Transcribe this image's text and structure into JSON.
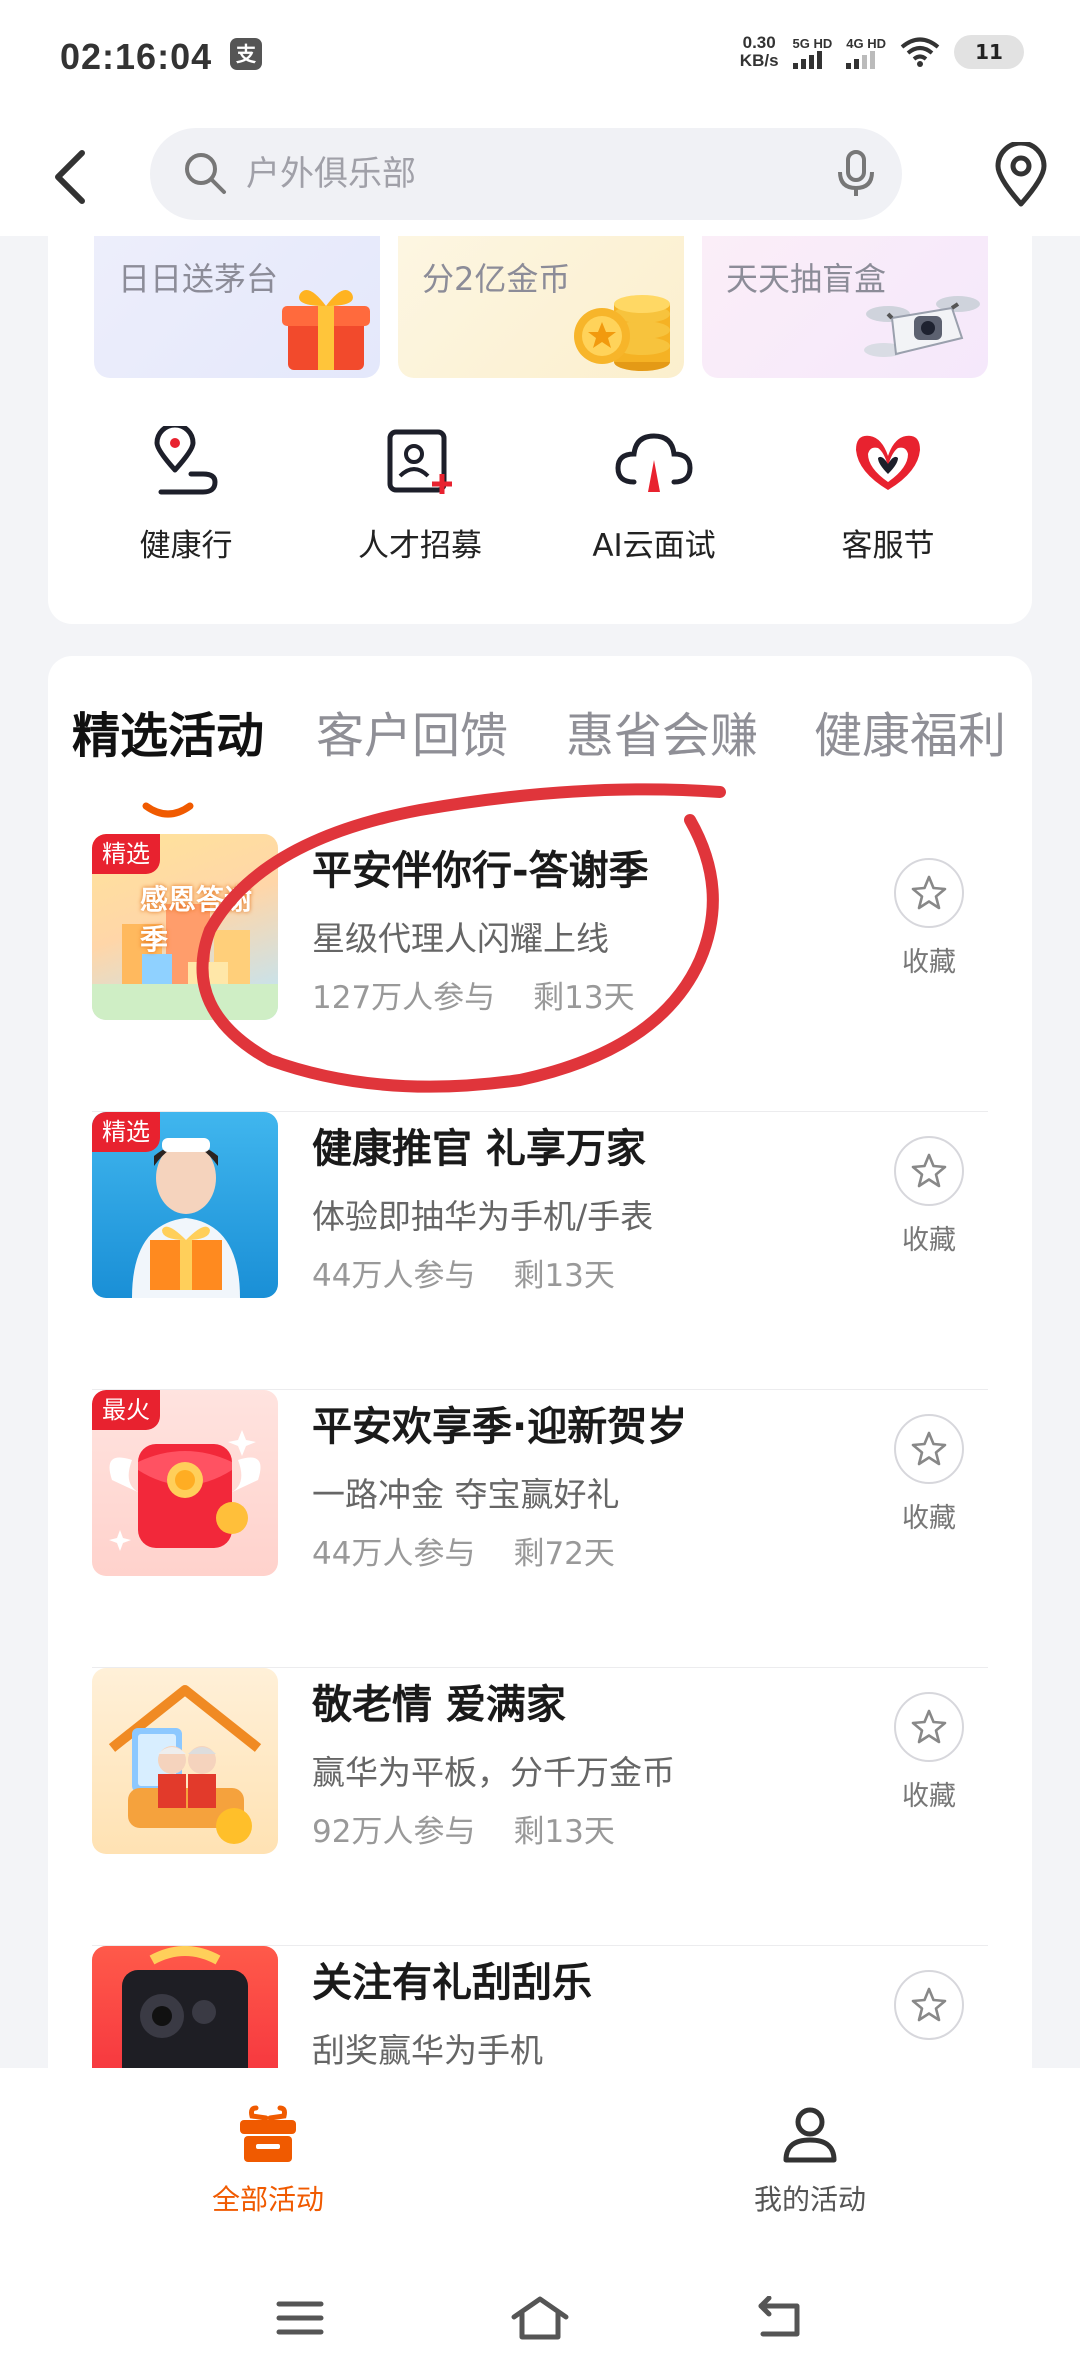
{
  "status_bar": {
    "time": "02:16:04",
    "app_icon": "支",
    "net_speed_value": "0.30",
    "net_speed_unit": "KB/s",
    "signal_1_label": "5G HD",
    "signal_2_label": "4G HD",
    "battery": "11"
  },
  "search": {
    "placeholder": "户外俱乐部"
  },
  "promos": [
    {
      "label": "日日送茅台",
      "icon": "gift-box-icon"
    },
    {
      "label": "分2亿金币",
      "icon": "gold-coins-icon"
    },
    {
      "label": "天天抽盲盒",
      "icon": "drone-icon"
    }
  ],
  "quick_actions": [
    {
      "label": "健康行",
      "icon": "location-route-icon"
    },
    {
      "label": "人才招募",
      "icon": "recruit-person-icon"
    },
    {
      "label": "AI云面试",
      "icon": "cloud-icon"
    },
    {
      "label": "客服节",
      "icon": "hands-heart-icon"
    }
  ],
  "tabs": [
    "精选活动",
    "客户回馈",
    "惠省会赚",
    "健康福利"
  ],
  "activities": [
    {
      "badge": "精选",
      "title": "平安伴你行-答谢季",
      "desc": "星级代理人闪耀上线",
      "participants": "127万人参与",
      "remaining": "剩13天",
      "fav": "收藏"
    },
    {
      "badge": "精选",
      "title": "健康推官 礼享万家",
      "desc": "体验即抽华为手机/手表",
      "participants": "44万人参与",
      "remaining": "剩13天",
      "fav": "收藏"
    },
    {
      "badge": "最火",
      "title": "平安欢享季·迎新贺岁",
      "desc": "一路冲金 夺宝赢好礼",
      "participants": "44万人参与",
      "remaining": "剩72天",
      "fav": "收藏"
    },
    {
      "badge": "",
      "title": "敬老情 爱满家",
      "desc": "赢华为平板，分千万金币",
      "participants": "92万人参与",
      "remaining": "剩13天",
      "fav": "收藏"
    },
    {
      "badge": "",
      "title": "关注有礼刮刮乐",
      "desc": "刮奖赢华为手机",
      "participants": "",
      "remaining": "",
      "fav": ""
    }
  ],
  "thumb_text": "感恩答谢季",
  "bottom_nav": {
    "all_label": "全部活动",
    "mine_label": "我的活动"
  },
  "colors": {
    "accent": "#f05a00",
    "badge_red": "#e8222f",
    "annotation_red": "#e0353b"
  }
}
